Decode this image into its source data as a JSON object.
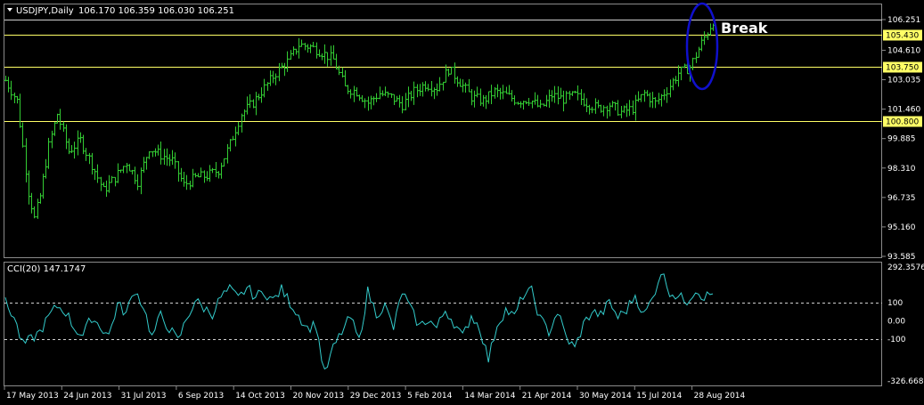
{
  "header": {
    "symbol": "USDJPY,Daily",
    "ohlc": "106.170 106.359 106.030 106.251"
  },
  "annotation": {
    "text": "Break"
  },
  "colors": {
    "background": "#000000",
    "candle": "#33cc33",
    "level": "#ffff66",
    "cci": "#33cccc",
    "annotation_ellipse": "#1010cc",
    "grid_text": "#ffffff"
  },
  "chart_data": [
    {
      "type": "bar",
      "subtype": "ohlc",
      "title": "USDJPY,Daily",
      "y_ticks": [
        "106.251",
        "104.610",
        "103.035",
        "101.460",
        "99.885",
        "98.310",
        "96.735",
        "95.160",
        "93.585"
      ],
      "ylim": [
        93.585,
        106.8
      ],
      "x_labels": [
        "17 May 2013",
        "24 Jun 2013",
        "31 Jul 2013",
        "6 Sep 2013",
        "14 Oct 2013",
        "20 Nov 2013",
        "29 Dec 2013",
        "5 Feb 2014",
        "14 Mar 2014",
        "21 Apr 2014",
        "30 May 2014",
        "15 Jul 2014",
        "28 Aug 2014"
      ],
      "levels": [
        {
          "value": "106.251",
          "highlight": false
        },
        {
          "value": "105.430",
          "highlight": true
        },
        {
          "value": "103.750",
          "highlight": true
        },
        {
          "value": "100.800",
          "highlight": true
        }
      ],
      "close_path": [
        [
          0,
          103.0
        ],
        [
          4,
          101.9
        ],
        [
          8,
          97.0
        ],
        [
          10,
          95.6
        ],
        [
          12,
          96.8
        ],
        [
          15,
          99.5
        ],
        [
          18,
          101.2
        ],
        [
          22,
          99.2
        ],
        [
          26,
          99.8
        ],
        [
          30,
          98.5
        ],
        [
          34,
          97.1
        ],
        [
          38,
          97.8
        ],
        [
          42,
          98.6
        ],
        [
          46,
          97.6
        ],
        [
          50,
          99.4
        ],
        [
          54,
          99.0
        ],
        [
          58,
          98.7
        ],
        [
          62,
          97.4
        ],
        [
          66,
          97.8
        ],
        [
          70,
          97.9
        ],
        [
          74,
          98.2
        ],
        [
          78,
          99.6
        ],
        [
          82,
          101.2
        ],
        [
          86,
          101.8
        ],
        [
          90,
          102.6
        ],
        [
          94,
          103.4
        ],
        [
          98,
          104.0
        ],
        [
          102,
          104.9
        ],
        [
          106,
          104.8
        ],
        [
          110,
          104.5
        ],
        [
          114,
          104.1
        ],
        [
          118,
          102.6
        ],
        [
          122,
          102.4
        ],
        [
          126,
          101.8
        ],
        [
          130,
          102.3
        ],
        [
          134,
          102.1
        ],
        [
          138,
          101.7
        ],
        [
          142,
          102.4
        ],
        [
          146,
          102.8
        ],
        [
          150,
          102.6
        ],
        [
          154,
          103.6
        ],
        [
          158,
          102.9
        ],
        [
          162,
          102.1
        ],
        [
          166,
          101.9
        ],
        [
          170,
          102.4
        ],
        [
          174,
          102.2
        ],
        [
          178,
          101.9
        ],
        [
          182,
          102.0
        ],
        [
          186,
          101.5
        ],
        [
          190,
          102.2
        ],
        [
          194,
          102.0
        ],
        [
          198,
          102.2
        ],
        [
          202,
          101.8
        ],
        [
          206,
          101.5
        ],
        [
          210,
          101.7
        ],
        [
          214,
          101.3
        ],
        [
          218,
          101.5
        ],
        [
          222,
          102.3
        ],
        [
          226,
          101.8
        ],
        [
          230,
          102.5
        ],
        [
          234,
          103.4
        ],
        [
          238,
          103.7
        ],
        [
          242,
          105.0
        ],
        [
          246,
          106.2
        ]
      ],
      "n_bars": 247
    },
    {
      "type": "line",
      "title": "CCI(20) 147.1747",
      "y_ticks": [
        "292.3576",
        "100",
        "0.00",
        "-100",
        "-326.6682"
      ],
      "ylim": [
        -326.6682,
        292.3576
      ],
      "reference_lines": [
        100,
        -100
      ],
      "series": [
        {
          "name": "CCI(20) 147.1747",
          "points": [
            [
              0,
              100
            ],
            [
              3,
              20
            ],
            [
              6,
              -130
            ],
            [
              9,
              -100
            ],
            [
              12,
              -60
            ],
            [
              15,
              20
            ],
            [
              18,
              80
            ],
            [
              21,
              50
            ],
            [
              24,
              -40
            ],
            [
              27,
              -80
            ],
            [
              30,
              20
            ],
            [
              33,
              -30
            ],
            [
              36,
              -80
            ],
            [
              39,
              90
            ],
            [
              42,
              40
            ],
            [
              45,
              170
            ],
            [
              48,
              80
            ],
            [
              51,
              -90
            ],
            [
              54,
              30
            ],
            [
              57,
              -40
            ],
            [
              60,
              -110
            ],
            [
              63,
              10
            ],
            [
              66,
              110
            ],
            [
              69,
              70
            ],
            [
              72,
              40
            ],
            [
              75,
              130
            ],
            [
              78,
              170
            ],
            [
              81,
              120
            ],
            [
              84,
              180
            ],
            [
              87,
              130
            ],
            [
              90,
              160
            ],
            [
              93,
              110
            ],
            [
              96,
              170
            ],
            [
              99,
              100
            ],
            [
              102,
              30
            ],
            [
              105,
              -40
            ],
            [
              108,
              -20
            ],
            [
              111,
              -290
            ],
            [
              114,
              -150
            ],
            [
              117,
              -60
            ],
            [
              120,
              20
            ],
            [
              123,
              -110
            ],
            [
              126,
              160
            ],
            [
              129,
              40
            ],
            [
              132,
              80
            ],
            [
              135,
              -40
            ],
            [
              138,
              160
            ],
            [
              141,
              60
            ],
            [
              144,
              -30
            ],
            [
              147,
              10
            ],
            [
              150,
              -40
            ],
            [
              153,
              60
            ],
            [
              156,
              -10
            ],
            [
              159,
              -90
            ],
            [
              162,
              30
            ],
            [
              165,
              -40
            ],
            [
              168,
              -210
            ],
            [
              171,
              -20
            ],
            [
              174,
              60
            ],
            [
              177,
              20
            ],
            [
              180,
              140
            ],
            [
              183,
              160
            ],
            [
              186,
              10
            ],
            [
              189,
              -60
            ],
            [
              192,
              50
            ],
            [
              195,
              -90
            ],
            [
              198,
              -150
            ],
            [
              201,
              -20
            ],
            [
              204,
              50
            ],
            [
              207,
              30
            ],
            [
              210,
              100
            ],
            [
              213,
              20
            ],
            [
              216,
              60
            ],
            [
              219,
              140
            ],
            [
              222,
              30
            ],
            [
              225,
              120
            ],
            [
              228,
              270
            ],
            [
              231,
              160
            ],
            [
              234,
              130
            ],
            [
              237,
              110
            ],
            [
              240,
              170
            ],
            [
              243,
              130
            ],
            [
              246,
              147
            ]
          ]
        }
      ]
    }
  ]
}
